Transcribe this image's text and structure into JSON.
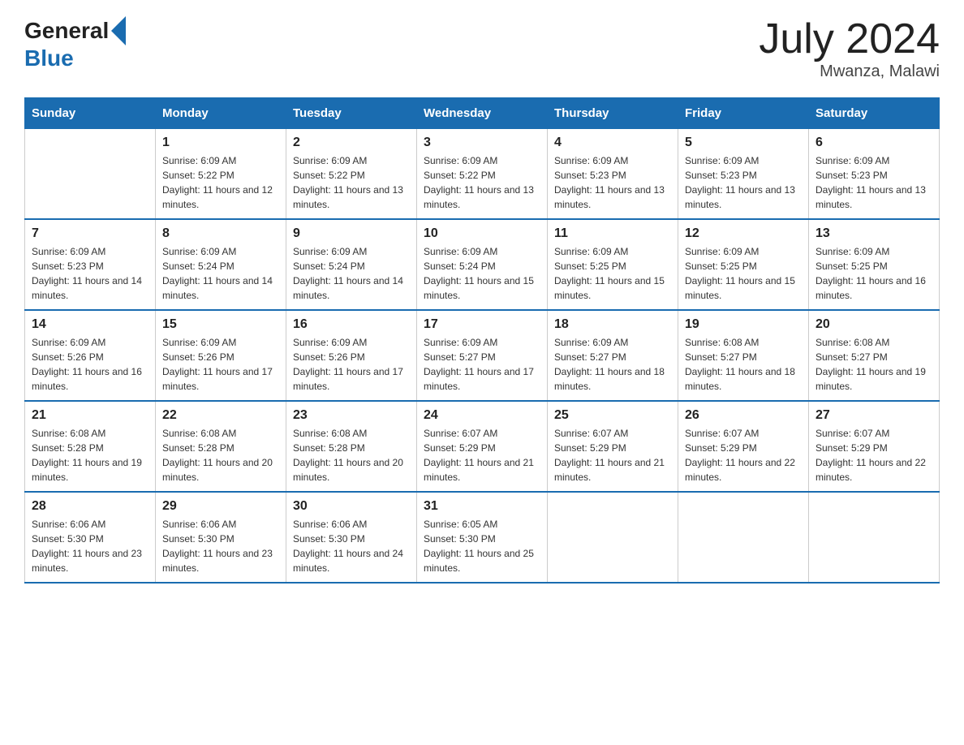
{
  "header": {
    "logo_text_general": "General",
    "logo_text_blue": "Blue",
    "title": "July 2024",
    "subtitle": "Mwanza, Malawi"
  },
  "calendar": {
    "days_of_week": [
      "Sunday",
      "Monday",
      "Tuesday",
      "Wednesday",
      "Thursday",
      "Friday",
      "Saturday"
    ],
    "weeks": [
      [
        {
          "day": "",
          "sunrise": "",
          "sunset": "",
          "daylight": ""
        },
        {
          "day": "1",
          "sunrise": "Sunrise: 6:09 AM",
          "sunset": "Sunset: 5:22 PM",
          "daylight": "Daylight: 11 hours and 12 minutes."
        },
        {
          "day": "2",
          "sunrise": "Sunrise: 6:09 AM",
          "sunset": "Sunset: 5:22 PM",
          "daylight": "Daylight: 11 hours and 13 minutes."
        },
        {
          "day": "3",
          "sunrise": "Sunrise: 6:09 AM",
          "sunset": "Sunset: 5:22 PM",
          "daylight": "Daylight: 11 hours and 13 minutes."
        },
        {
          "day": "4",
          "sunrise": "Sunrise: 6:09 AM",
          "sunset": "Sunset: 5:23 PM",
          "daylight": "Daylight: 11 hours and 13 minutes."
        },
        {
          "day": "5",
          "sunrise": "Sunrise: 6:09 AM",
          "sunset": "Sunset: 5:23 PM",
          "daylight": "Daylight: 11 hours and 13 minutes."
        },
        {
          "day": "6",
          "sunrise": "Sunrise: 6:09 AM",
          "sunset": "Sunset: 5:23 PM",
          "daylight": "Daylight: 11 hours and 13 minutes."
        }
      ],
      [
        {
          "day": "7",
          "sunrise": "Sunrise: 6:09 AM",
          "sunset": "Sunset: 5:23 PM",
          "daylight": "Daylight: 11 hours and 14 minutes."
        },
        {
          "day": "8",
          "sunrise": "Sunrise: 6:09 AM",
          "sunset": "Sunset: 5:24 PM",
          "daylight": "Daylight: 11 hours and 14 minutes."
        },
        {
          "day": "9",
          "sunrise": "Sunrise: 6:09 AM",
          "sunset": "Sunset: 5:24 PM",
          "daylight": "Daylight: 11 hours and 14 minutes."
        },
        {
          "day": "10",
          "sunrise": "Sunrise: 6:09 AM",
          "sunset": "Sunset: 5:24 PM",
          "daylight": "Daylight: 11 hours and 15 minutes."
        },
        {
          "day": "11",
          "sunrise": "Sunrise: 6:09 AM",
          "sunset": "Sunset: 5:25 PM",
          "daylight": "Daylight: 11 hours and 15 minutes."
        },
        {
          "day": "12",
          "sunrise": "Sunrise: 6:09 AM",
          "sunset": "Sunset: 5:25 PM",
          "daylight": "Daylight: 11 hours and 15 minutes."
        },
        {
          "day": "13",
          "sunrise": "Sunrise: 6:09 AM",
          "sunset": "Sunset: 5:25 PM",
          "daylight": "Daylight: 11 hours and 16 minutes."
        }
      ],
      [
        {
          "day": "14",
          "sunrise": "Sunrise: 6:09 AM",
          "sunset": "Sunset: 5:26 PM",
          "daylight": "Daylight: 11 hours and 16 minutes."
        },
        {
          "day": "15",
          "sunrise": "Sunrise: 6:09 AM",
          "sunset": "Sunset: 5:26 PM",
          "daylight": "Daylight: 11 hours and 17 minutes."
        },
        {
          "day": "16",
          "sunrise": "Sunrise: 6:09 AM",
          "sunset": "Sunset: 5:26 PM",
          "daylight": "Daylight: 11 hours and 17 minutes."
        },
        {
          "day": "17",
          "sunrise": "Sunrise: 6:09 AM",
          "sunset": "Sunset: 5:27 PM",
          "daylight": "Daylight: 11 hours and 17 minutes."
        },
        {
          "day": "18",
          "sunrise": "Sunrise: 6:09 AM",
          "sunset": "Sunset: 5:27 PM",
          "daylight": "Daylight: 11 hours and 18 minutes."
        },
        {
          "day": "19",
          "sunrise": "Sunrise: 6:08 AM",
          "sunset": "Sunset: 5:27 PM",
          "daylight": "Daylight: 11 hours and 18 minutes."
        },
        {
          "day": "20",
          "sunrise": "Sunrise: 6:08 AM",
          "sunset": "Sunset: 5:27 PM",
          "daylight": "Daylight: 11 hours and 19 minutes."
        }
      ],
      [
        {
          "day": "21",
          "sunrise": "Sunrise: 6:08 AM",
          "sunset": "Sunset: 5:28 PM",
          "daylight": "Daylight: 11 hours and 19 minutes."
        },
        {
          "day": "22",
          "sunrise": "Sunrise: 6:08 AM",
          "sunset": "Sunset: 5:28 PM",
          "daylight": "Daylight: 11 hours and 20 minutes."
        },
        {
          "day": "23",
          "sunrise": "Sunrise: 6:08 AM",
          "sunset": "Sunset: 5:28 PM",
          "daylight": "Daylight: 11 hours and 20 minutes."
        },
        {
          "day": "24",
          "sunrise": "Sunrise: 6:07 AM",
          "sunset": "Sunset: 5:29 PM",
          "daylight": "Daylight: 11 hours and 21 minutes."
        },
        {
          "day": "25",
          "sunrise": "Sunrise: 6:07 AM",
          "sunset": "Sunset: 5:29 PM",
          "daylight": "Daylight: 11 hours and 21 minutes."
        },
        {
          "day": "26",
          "sunrise": "Sunrise: 6:07 AM",
          "sunset": "Sunset: 5:29 PM",
          "daylight": "Daylight: 11 hours and 22 minutes."
        },
        {
          "day": "27",
          "sunrise": "Sunrise: 6:07 AM",
          "sunset": "Sunset: 5:29 PM",
          "daylight": "Daylight: 11 hours and 22 minutes."
        }
      ],
      [
        {
          "day": "28",
          "sunrise": "Sunrise: 6:06 AM",
          "sunset": "Sunset: 5:30 PM",
          "daylight": "Daylight: 11 hours and 23 minutes."
        },
        {
          "day": "29",
          "sunrise": "Sunrise: 6:06 AM",
          "sunset": "Sunset: 5:30 PM",
          "daylight": "Daylight: 11 hours and 23 minutes."
        },
        {
          "day": "30",
          "sunrise": "Sunrise: 6:06 AM",
          "sunset": "Sunset: 5:30 PM",
          "daylight": "Daylight: 11 hours and 24 minutes."
        },
        {
          "day": "31",
          "sunrise": "Sunrise: 6:05 AM",
          "sunset": "Sunset: 5:30 PM",
          "daylight": "Daylight: 11 hours and 25 minutes."
        },
        {
          "day": "",
          "sunrise": "",
          "sunset": "",
          "daylight": ""
        },
        {
          "day": "",
          "sunrise": "",
          "sunset": "",
          "daylight": ""
        },
        {
          "day": "",
          "sunrise": "",
          "sunset": "",
          "daylight": ""
        }
      ]
    ]
  }
}
